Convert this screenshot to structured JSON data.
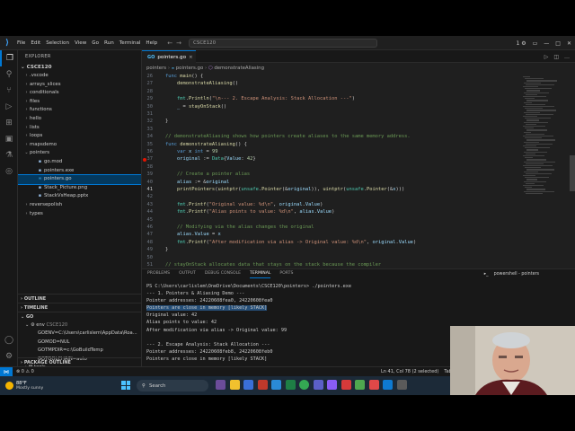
{
  "menu": [
    "File",
    "Edit",
    "Selection",
    "View",
    "Go",
    "Run",
    "Terminal",
    "Help"
  ],
  "title_search": "CSCE120",
  "title_right_badge": "1",
  "explorer": {
    "header": "EXPLORER",
    "root": "CSCE120",
    "items": [
      {
        "label": ".vscode",
        "type": "folder",
        "depth": 0
      },
      {
        "label": "arrays_slices",
        "type": "folder",
        "depth": 0
      },
      {
        "label": "conditionals",
        "type": "folder",
        "depth": 0
      },
      {
        "label": "files",
        "type": "folder",
        "depth": 0
      },
      {
        "label": "functions",
        "type": "folder",
        "depth": 0
      },
      {
        "label": "hello",
        "type": "folder",
        "depth": 0
      },
      {
        "label": "lists",
        "type": "folder",
        "depth": 0
      },
      {
        "label": "loops",
        "type": "folder",
        "depth": 0
      },
      {
        "label": "mapsdemo",
        "type": "folder",
        "depth": 0
      },
      {
        "label": "pointers",
        "type": "folder-open",
        "depth": 0
      },
      {
        "label": "go.mod",
        "type": "file",
        "depth": 1
      },
      {
        "label": "pointers.exe",
        "type": "file",
        "depth": 1
      },
      {
        "label": "pointers.go",
        "type": "go",
        "depth": 1,
        "selected": true
      },
      {
        "label": "Stack_Picture.png",
        "type": "file",
        "depth": 1
      },
      {
        "label": "StackVsHeap.pptx",
        "type": "file",
        "depth": 1
      },
      {
        "label": "reversepolish",
        "type": "folder",
        "depth": 0
      },
      {
        "label": "types",
        "type": "folder",
        "depth": 0
      }
    ],
    "outline": "OUTLINE",
    "timeline": "TIMELINE",
    "go": "GO",
    "env_header": "env",
    "env_version": "CSCE120",
    "env": [
      "GOENV=C:\\Users\\carlislem\\AppData\\Roa...",
      "GOMOD=NUL",
      "GOTMPDIR=c:\\GoBuildTemp",
      "GOTOOLCHAIN=auto"
    ],
    "tools": "tools",
    "package_outline": "PACKAGE OUTLINE"
  },
  "tab": {
    "label": "pointers.go",
    "close": "×",
    "go_badge": "GO"
  },
  "breadcrumbs": [
    "pointers",
    "pointers.go",
    "demonstrateAliasing"
  ],
  "code_lines": [
    {
      "n": "26",
      "text": "func main() {"
    },
    {
      "n": "27",
      "text": "    demonstrateAliasing()"
    },
    {
      "n": "28",
      "text": ""
    },
    {
      "n": "29",
      "text": "    fmt.Println(\"\\n--- 2. Escape Analysis: Stack Allocation ---\")"
    },
    {
      "n": "30",
      "text": "    _ = stayOnStack()"
    },
    {
      "n": "31",
      "text": ""
    },
    {
      "n": "32",
      "text": "}"
    },
    {
      "n": "33",
      "text": ""
    },
    {
      "n": "34",
      "text": "// demonstrateAliasing shows how pointers create aliases to the same memory address."
    },
    {
      "n": "35",
      "text": "func demonstrateAliasing() {"
    },
    {
      "n": "36",
      "text": "    var x int = 99"
    },
    {
      "n": "37",
      "text": "    original := Data{Value: 42}"
    },
    {
      "n": "38",
      "text": ""
    },
    {
      "n": "39",
      "text": "    // Create a pointer alias"
    },
    {
      "n": "40",
      "text": "    alias := &original"
    },
    {
      "n": "41",
      "text": "    printPointers(uintptr(unsafe.Pointer(&original)), uintptr(unsafe.Pointer(&x)))"
    },
    {
      "n": "42",
      "text": ""
    },
    {
      "n": "43",
      "text": "    fmt.Printf(\"Original value: %d\\n\", original.Value)"
    },
    {
      "n": "44",
      "text": "    fmt.Printf(\"Alias points to value: %d\\n\", alias.Value)"
    },
    {
      "n": "45",
      "text": ""
    },
    {
      "n": "46",
      "text": "    // Modifying via the alias changes the original"
    },
    {
      "n": "47",
      "text": "    alias.Value = x"
    },
    {
      "n": "48",
      "text": "    fmt.Printf(\"After modification via alias -> Original value: %d\\n\", original.Value)"
    },
    {
      "n": "49",
      "text": "}"
    },
    {
      "n": "50",
      "text": ""
    },
    {
      "n": "51",
      "text": "// stayOnStack allocates data that stays on the stack because the compiler"
    }
  ],
  "panel_tabs": [
    "PROBLEMS",
    "OUTPUT",
    "DEBUG CONSOLE",
    "TERMINAL",
    "PORTS"
  ],
  "panel_right": "powershell - pointers",
  "terminal_lines": [
    "PS C:\\Users\\carlislem\\OneDrive\\Documents\\CSCE120\\pointers> ./pointers.exe",
    "--- 1. Pointers & Aliasing Demo ---",
    "Pointer addresses: 24220608fea0, 24220608fea0",
    "Pointers are close in memory [likely STACK]",
    "Original value: 42",
    "Alias points to value: 42",
    "After modification via alias -> Original value: 99",
    "",
    "--- 2. Escape Analysis: Stack Allocation ---",
    "Pointer addresses: 24220608feb8, 24220608feb0",
    "Pointers are close in memory [likely STACK]"
  ],
  "status": {
    "errors": "0",
    "warnings": "0",
    "position": "Ln 41, Col 78 (2 selected)",
    "tab": "Tab S"
  },
  "taskbar": {
    "temp": "88°F",
    "weather": "Mostly sunny",
    "search": "Search"
  },
  "colors": {
    "accent": "#0078d4",
    "keyword": "#569cd6",
    "function": "#dcdcaa",
    "string": "#ce9178",
    "comment": "#6a9955",
    "type": "#4ec9b0",
    "number": "#b5cea8",
    "variable": "#9cdcfe"
  }
}
